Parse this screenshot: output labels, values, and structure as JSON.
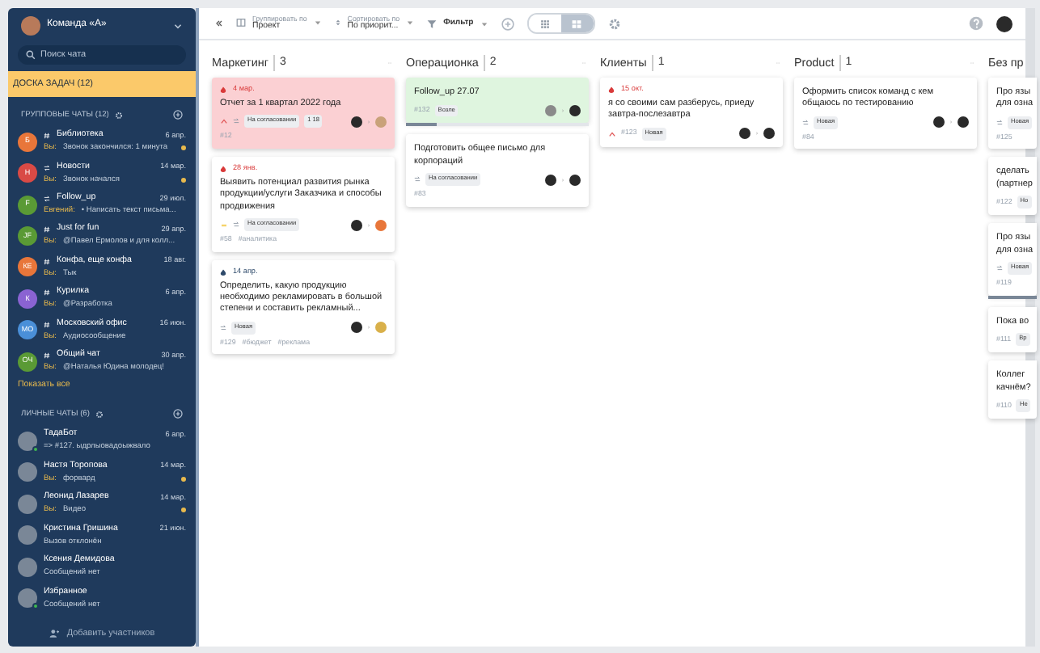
{
  "sidebar": {
    "team": "Команда «А»",
    "search": {
      "placeholder": "Поиск чата"
    },
    "board_button": "ДОСКА ЗАДАЧ (12)",
    "group_section": {
      "title": "ГРУППОВЫЕ ЧАТЫ (12)"
    },
    "group_chats": [
      {
        "initials": "Б",
        "color": "#e8763a",
        "kind": "hash",
        "name": "Библиотека",
        "time": "6 апр.",
        "sender": "Вы:",
        "message": "Звонок закончился: 1 минута",
        "unread": true
      },
      {
        "initials": "Н",
        "color": "#d94a45",
        "kind": "broadcast",
        "name": "Новости",
        "time": "14 мар.",
        "sender": "Вы:",
        "message": "Звонок начался",
        "unread": true
      },
      {
        "initials": "F",
        "color": "#5a9a35",
        "kind": "broadcast",
        "name": "Follow_up",
        "time": "29 июл.",
        "sender": "Евгений:",
        "message": "• Написать текст письма...",
        "unread": false
      },
      {
        "initials": "JF",
        "color": "#5a9a35",
        "kind": "hash",
        "name": "Just for fun",
        "time": "29 апр.",
        "sender": "Вы:",
        "message": "@Павел Ермолов и для колл...",
        "unread": false
      },
      {
        "initials": "КЕ",
        "color": "#e8763a",
        "kind": "hash",
        "name": "Конфа, еще конфа",
        "time": "18 авг.",
        "sender": "Вы:",
        "message": "Тык",
        "unread": false
      },
      {
        "initials": "К",
        "color": "#8a63d2",
        "kind": "hash",
        "name": "Курилка",
        "time": "6 апр.",
        "sender": "Вы:",
        "message": "@Разработка",
        "unread": false
      },
      {
        "initials": "МО",
        "color": "#4a8fd8",
        "kind": "hash",
        "name": "Московский офис",
        "time": "16 июн.",
        "sender": "Вы:",
        "message": "Аудиосообщение",
        "unread": false
      },
      {
        "initials": "ОЧ",
        "color": "#5a9a35",
        "kind": "hash",
        "name": "Общий чат",
        "time": "30 апр.",
        "sender": "Вы:",
        "message": "@Наталья Юдина молодец!",
        "unread": false
      }
    ],
    "show_all": "Показать все",
    "personal_section": {
      "title": "ЛИЧНЫЕ ЧАТЫ (6)"
    },
    "personal_chats": [
      {
        "name": "ТадаБот",
        "time": "6 апр.",
        "message": "=> #127. ыдрлыовадоыжвало",
        "unread": false,
        "online": true
      },
      {
        "name": "Настя Торопова",
        "time": "14 мар.",
        "sender": "Вы:",
        "message": "форвард",
        "unread": true,
        "online": false
      },
      {
        "name": "Леонид Лазарев",
        "time": "14 мар.",
        "sender": "Вы:",
        "message": "Видео",
        "unread": true,
        "online": false
      },
      {
        "name": "Кристина Гришина",
        "time": "21 июн.",
        "message": "Вызов отклонён",
        "unread": false,
        "online": false
      },
      {
        "name": "Ксения Демидова",
        "message": "Сообщений нет",
        "unread": false,
        "online": false
      },
      {
        "name": "Избранное",
        "message": "Сообщений нет",
        "unread": false,
        "online": true
      }
    ],
    "add_members": "Добавить участников"
  },
  "toolbar": {
    "group_by": {
      "label": "Группировать по",
      "value": "Проект"
    },
    "sort_by": {
      "label": "Сортировать по",
      "value": "По приорит..."
    },
    "filter": "Фильтр",
    "views": [
      {
        "kind": "grid",
        "selected": false
      },
      {
        "kind": "board",
        "selected": true
      }
    ]
  },
  "columns": [
    {
      "title": "Маркетинг",
      "count": "3",
      "cards": [
        {
          "kind": "overdue",
          "due": "4 мар.",
          "late": true,
          "title": "Отчет за 1 квартал 2022 года",
          "priority": {
            "kind": "high"
          },
          "status": "На согласовании",
          "badge": "1 18",
          "number": "#12",
          "status_inline": false,
          "assignees": [
            {
              "color": "#2a2a2a"
            },
            {
              "color": "#c9a27a"
            }
          ]
        },
        {
          "kind": "normal",
          "due": "28 янв.",
          "late": true,
          "title": "Выявить потенциал развития рынка продукции/услуги Заказчика и способы продвижения",
          "priority": {
            "kind": "low"
          },
          "status": "На согласовании",
          "number": "#58",
          "tags": [
            "#аналитика"
          ],
          "status_inline": false,
          "assignees": [
            {
              "color": "#2a2a2a"
            },
            {
              "color": "#e8763a"
            }
          ]
        },
        {
          "kind": "normal",
          "due": "14 апр.",
          "late": false,
          "title": "Определить, какую продукцию необходимо рекламировать в большой степени и составить рекламный...",
          "status": "Новая",
          "number": "#129",
          "tags": [
            "#бюджет",
            "#реклама"
          ],
          "status_inline": false,
          "assignees": [
            {
              "color": "#2a2a2a"
            },
            {
              "color": "#d9b04a"
            }
          ]
        }
      ]
    },
    {
      "title": "Операционка",
      "count": "2",
      "cards": [
        {
          "kind": "done",
          "title": "Follow_up 27.07",
          "status": "Возле",
          "number": "#132",
          "status_inline": true,
          "assignees": [
            {
              "color": "#8a8a8a"
            },
            {
              "color": "#2a2a2a"
            }
          ],
          "progress": {
            "level": 0.17
          }
        },
        {
          "kind": "normal",
          "title": "Подготовить общее письмо для корпораций",
          "status": "На согласовании",
          "number": "#83",
          "status_inline": false,
          "assignees": [
            {
              "color": "#2a2a2a"
            },
            {
              "color": "#2a2a2a"
            }
          ]
        }
      ]
    },
    {
      "title": "Клиенты",
      "count": "1",
      "cards": [
        {
          "kind": "normal",
          "due": "15 окт.",
          "late": true,
          "title": "я со своими сам разберусь, приеду завтра-послезавтра",
          "priority": {
            "kind": "high"
          },
          "status": "Новая",
          "number": "#123",
          "status_inline": true,
          "assignees": [
            {
              "color": "#2a2a2a"
            },
            {
              "color": "#2a2a2a"
            }
          ]
        }
      ]
    },
    {
      "title": "Product",
      "count": "1",
      "cards": [
        {
          "kind": "normal",
          "title": "Оформить список команд с кем общаюсь по тестированию",
          "status": "Новая",
          "number": "#84",
          "status_inline": false,
          "assignees": [
            {
              "color": "#2a2a2a"
            },
            {
              "color": "#2a2a2a"
            }
          ]
        }
      ]
    },
    {
      "title": "Без пр",
      "cards": [
        {
          "kind": "normal",
          "title": "Про язы\nдля озна",
          "status": "Новая",
          "number": "#125",
          "status_inline": false
        },
        {
          "kind": "normal",
          "title": "сделать\n(партнер",
          "status": "Но",
          "number": "#122",
          "status_inline": true
        },
        {
          "kind": "normal",
          "title": "Про язы\nдля озна",
          "status": "Новая",
          "number": "#119",
          "status_inline": false,
          "progress": {
            "level": 1
          }
        },
        {
          "kind": "normal",
          "title": "Пока во",
          "status": "Вр",
          "number": "#111",
          "status_inline": true
        },
        {
          "kind": "normal",
          "title": "Коллег\nкачнём?",
          "status": "Не",
          "number": "#110",
          "status_inline": true
        }
      ]
    }
  ]
}
